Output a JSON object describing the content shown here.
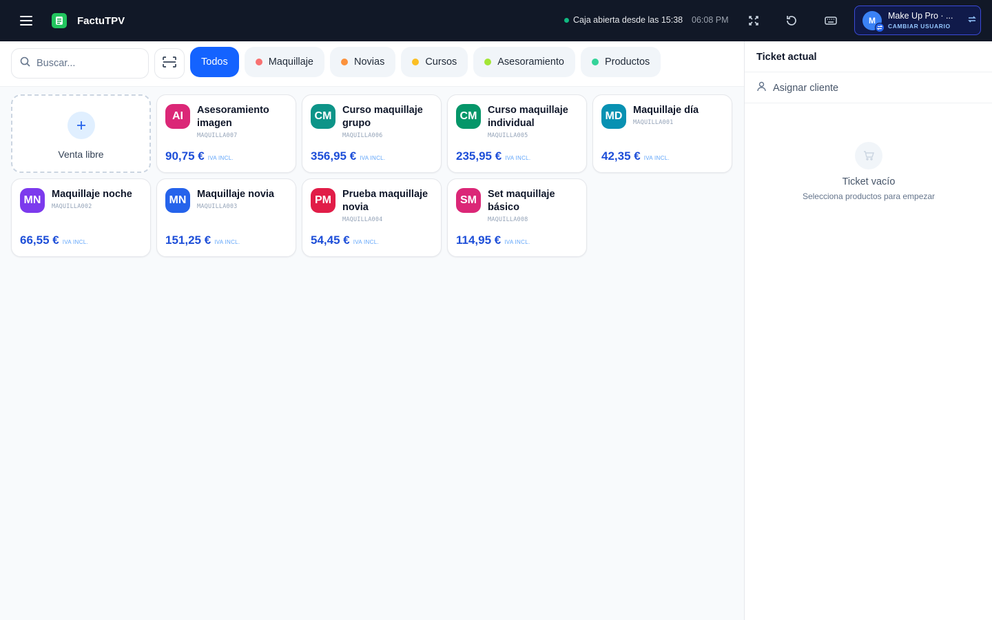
{
  "header": {
    "app_title": "FactuTPV",
    "status_text": "Caja abierta desde las 15:38",
    "clock": "06:08 PM",
    "user": {
      "avatar_initial": "M",
      "name": "Make Up Pro · ...",
      "switch_label": "CAMBIAR USUARIO"
    },
    "icons": [
      "menu-icon",
      "app-logo-icon",
      "fullscreen-icon",
      "history-icon",
      "keyboard-icon",
      "swap-icon"
    ]
  },
  "search": {
    "placeholder": "Buscar...",
    "value": ""
  },
  "categories": [
    {
      "label": "Todos",
      "active": true,
      "dot_color": ""
    },
    {
      "label": "Maquillaje",
      "active": false,
      "dot_color": "#f87171"
    },
    {
      "label": "Novias",
      "active": false,
      "dot_color": "#fb923c"
    },
    {
      "label": "Cursos",
      "active": false,
      "dot_color": "#fbbf24"
    },
    {
      "label": "Asesoramiento",
      "active": false,
      "dot_color": "#a3e635"
    },
    {
      "label": "Productos",
      "active": false,
      "dot_color": "#34d399"
    }
  ],
  "free_sale": {
    "label": "Venta libre"
  },
  "products": [
    {
      "initials": "AI",
      "name": "Asesoramiento imagen",
      "sku": "MAQUILLA007",
      "price": "90,75 €",
      "tax": "IVA INCL.",
      "color": "#db2777"
    },
    {
      "initials": "CM",
      "name": "Curso maquillaje grupo",
      "sku": "MAQUILLA006",
      "price": "356,95 €",
      "tax": "IVA INCL.",
      "color": "#0d9488"
    },
    {
      "initials": "CM",
      "name": "Curso maquillaje individual",
      "sku": "MAQUILLA005",
      "price": "235,95 €",
      "tax": "IVA INCL.",
      "color": "#059669"
    },
    {
      "initials": "MD",
      "name": "Maquillaje día",
      "sku": "MAQUILLA001",
      "price": "42,35 €",
      "tax": "IVA INCL.",
      "color": "#0891b2"
    },
    {
      "initials": "MN",
      "name": "Maquillaje noche",
      "sku": "MAQUILLA002",
      "price": "66,55 €",
      "tax": "IVA INCL.",
      "color": "#7c3aed"
    },
    {
      "initials": "MN",
      "name": "Maquillaje novia",
      "sku": "MAQUILLA003",
      "price": "151,25 €",
      "tax": "IVA INCL.",
      "color": "#2563eb"
    },
    {
      "initials": "PM",
      "name": "Prueba maquillaje novia",
      "sku": "MAQUILLA004",
      "price": "54,45 €",
      "tax": "IVA INCL.",
      "color": "#e11d48"
    },
    {
      "initials": "SM",
      "name": "Set maquillaje básico",
      "sku": "MAQUILLA008",
      "price": "114,95 €",
      "tax": "IVA INCL.",
      "color": "#db2777"
    }
  ],
  "ticket": {
    "title": "Ticket actual",
    "assign_client": "Asignar cliente",
    "empty_title": "Ticket vacío",
    "empty_subtitle": "Selecciona productos para empezar"
  }
}
